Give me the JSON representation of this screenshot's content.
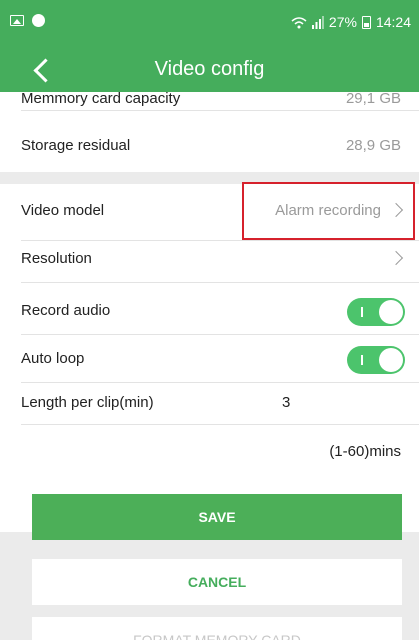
{
  "status_bar": {
    "battery": "27%",
    "time": "14:24",
    "icons": [
      "image-icon",
      "chat-icon",
      "wifi-icon",
      "signal-icon",
      "battery-icon"
    ]
  },
  "header": {
    "title": "Video config",
    "back_icon": "chevron-left-icon"
  },
  "storage": {
    "capacity_label": "Memmory card capacity",
    "capacity_value": "29,1 GB",
    "residual_label": "Storage residual",
    "residual_value": "28,9 GB"
  },
  "settings": {
    "video_model_label": "Video model",
    "video_model_value": "Alarm recording",
    "resolution_label": "Resolution",
    "record_audio_label": "Record audio",
    "record_audio_on": true,
    "auto_loop_label": "Auto loop",
    "auto_loop_on": true,
    "length_label": "Length per clip(min)",
    "length_value": "3",
    "length_hint": "(1-60)mins"
  },
  "actions": {
    "save": "SAVE",
    "cancel": "CANCEL",
    "format": "FORMAT MEMORY CARD"
  },
  "colors": {
    "accent": "#45ad5c",
    "toggle_on": "#4cc46c",
    "highlight": "#d6212c"
  }
}
